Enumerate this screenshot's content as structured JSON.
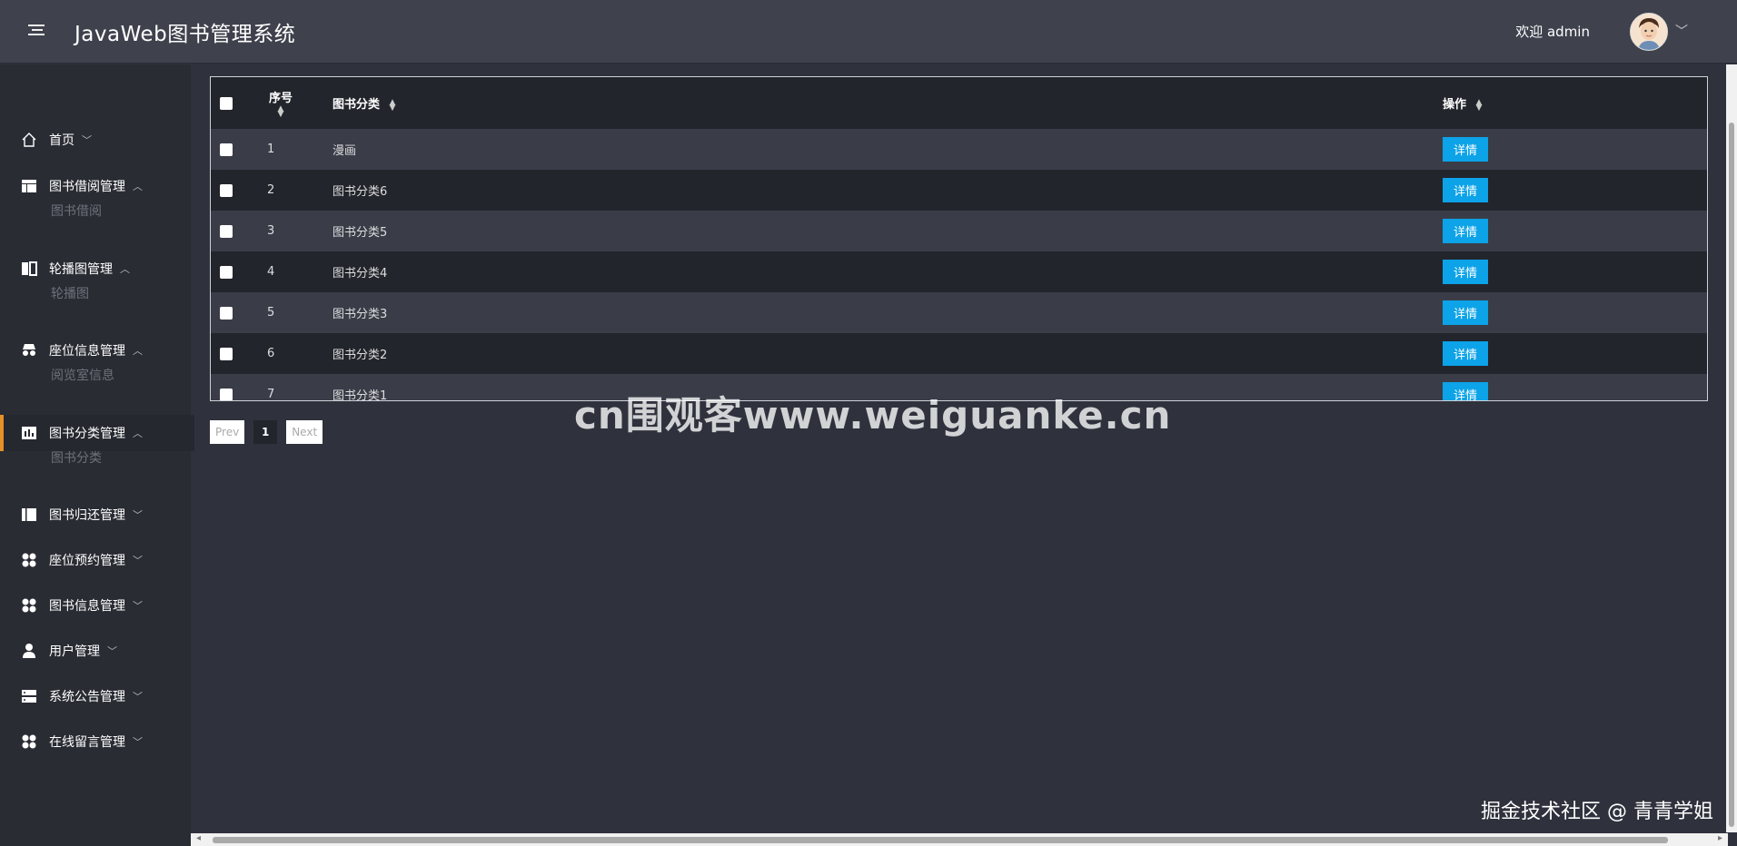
{
  "header": {
    "title": "JavaWeb图书管理系统",
    "welcome": "欢迎 admin"
  },
  "sidebar": {
    "items": [
      {
        "label": "首页",
        "icon": "home-icon",
        "chev": "﹀"
      },
      {
        "label": "图书借阅管理",
        "icon": "table-icon",
        "chev": "︿",
        "sub": "图书借阅"
      },
      {
        "label": "轮播图管理",
        "icon": "columns-icon",
        "chev": "︿",
        "sub": "轮播图"
      },
      {
        "label": "座位信息管理",
        "icon": "incognito-icon",
        "chev": "︿",
        "sub": "阅览室信息"
      },
      {
        "label": "图书分类管理",
        "icon": "bar-chart-icon",
        "chev": "︿",
        "sub": "图书分类"
      },
      {
        "label": "图书归还管理",
        "icon": "book-icon",
        "chev": "﹀"
      },
      {
        "label": "座位预约管理",
        "icon": "grid-dots-icon",
        "chev": "﹀"
      },
      {
        "label": "图书信息管理",
        "icon": "grid-dots-icon",
        "chev": "﹀"
      },
      {
        "label": "用户管理",
        "icon": "user-icon",
        "chev": "﹀"
      },
      {
        "label": "系统公告管理",
        "icon": "server-icon",
        "chev": "﹀"
      },
      {
        "label": "在线留言管理",
        "icon": "grid-dots-icon",
        "chev": "﹀"
      }
    ]
  },
  "table": {
    "headers": {
      "index": "序号",
      "category": "图书分类",
      "action": "操作"
    },
    "rows": [
      {
        "index": "1",
        "category": "漫画",
        "action": "详情"
      },
      {
        "index": "2",
        "category": "图书分类6",
        "action": "详情"
      },
      {
        "index": "3",
        "category": "图书分类5",
        "action": "详情"
      },
      {
        "index": "4",
        "category": "图书分类4",
        "action": "详情"
      },
      {
        "index": "5",
        "category": "图书分类3",
        "action": "详情"
      },
      {
        "index": "6",
        "category": "图书分类2",
        "action": "详情"
      },
      {
        "index": "7",
        "category": "图书分类1",
        "action": "详情"
      }
    ]
  },
  "pager": {
    "prev": "Prev",
    "current": "1",
    "next": "Next"
  },
  "overlay": {
    "watermark": "cn围观客www.weiguanke.cn",
    "credit": "掘金技术社区 @ 青青学姐"
  },
  "colors": {
    "accent": "#e49125",
    "button": "#0ca3e8",
    "header_bg": "#3f424d",
    "sidebar_bg": "#2a2c34"
  }
}
